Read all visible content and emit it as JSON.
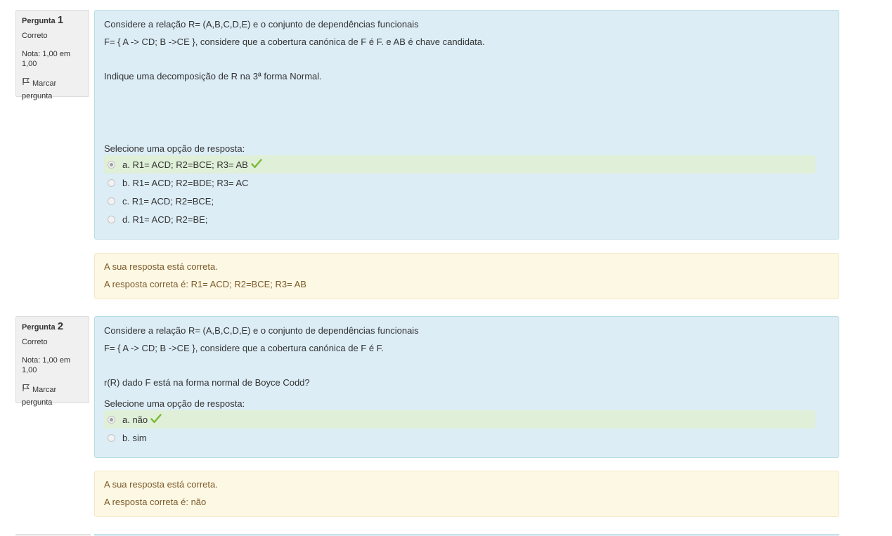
{
  "questions": [
    {
      "label": "Pergunta",
      "number": "1",
      "state": "Correto",
      "grade": "Nota: 1,00 em 1,00",
      "flag_line1": "Marcar",
      "flag_line2": "pergunta",
      "text": [
        "Considere a relação R= (A,B,C,D,E) e o conjunto de dependências funcionais",
        "F= { A -> CD; B ->CE }, considere que a cobertura canónica de F é F. e AB é chave candidata.",
        "Indique uma decomposição de R na 3ª forma Normal."
      ],
      "prompt": "Selecione uma opção de resposta:",
      "options": [
        {
          "label": "a. R1= ACD; R2=BCE; R3= AB",
          "selected": true,
          "correct": true
        },
        {
          "label": "b. R1= ACD; R2=BDE; R3= AC",
          "selected": false,
          "correct": false
        },
        {
          "label": "c. R1= ACD; R2=BCE;",
          "selected": false,
          "correct": false
        },
        {
          "label": "d. R1= ACD; R2=BE;",
          "selected": false,
          "correct": false
        }
      ],
      "feedback": {
        "status": "A sua resposta está correta.",
        "right_answer": "A resposta correta é: R1= ACD; R2=BCE; R3= AB"
      }
    },
    {
      "label": "Pergunta",
      "number": "2",
      "state": "Correto",
      "grade": "Nota: 1,00 em 1,00",
      "flag_line1": "Marcar",
      "flag_line2": "pergunta",
      "text": [
        "Considere a relação R= (A,B,C,D,E) e o conjunto de dependências funcionais",
        "F= { A -> CD; B ->CE }, considere que a cobertura canónica de F é F.",
        "r(R) dado F está na forma normal de Boyce Codd?"
      ],
      "prompt": "Selecione uma opção de resposta:",
      "options": [
        {
          "label": "a. não",
          "selected": true,
          "correct": true
        },
        {
          "label": "b. sim",
          "selected": false,
          "correct": false
        }
      ],
      "feedback": {
        "status": "A sua resposta está correta.",
        "right_answer": "A resposta correta é: não"
      }
    }
  ],
  "colors": {
    "question_bg": "#dcedf6",
    "info_bg": "#f0f0f0",
    "correct_option_bg": "#dfefd8",
    "feedback_bg": "#fcf8e4",
    "feedback_text": "#7d5a29",
    "check": "#7ab834"
  },
  "icons": {
    "flag": "flag-icon",
    "check": "check-icon",
    "radio": "radio-icon"
  }
}
